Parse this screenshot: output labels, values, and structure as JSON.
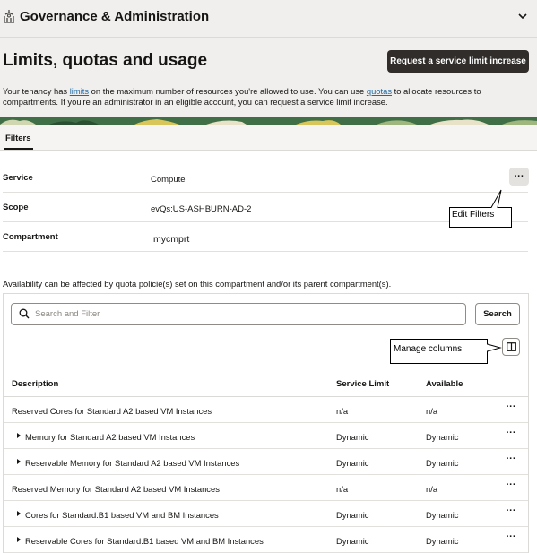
{
  "section": {
    "title": "Governance & Administration"
  },
  "page": {
    "title": "Limits, quotas and usage",
    "request_button": "Request a service limit increase",
    "intro": {
      "p1": "Your tenancy has ",
      "link1": "limits",
      "p2": " on the maximum number of resources you're allowed to use. You can use ",
      "link2": "quotas",
      "p3": " to allocate resources to compartments. If you're an administrator in an eligible account, you can request a service limit increase."
    }
  },
  "tabs": {
    "filters": "Filters"
  },
  "filters": {
    "service_label": "Service",
    "service_value": "Compute",
    "scope_label": "Scope",
    "scope_value": "evQs:US-ASHBURN-AD-2",
    "compartment_label": "Compartment",
    "compartment_value": "mycmprt",
    "more_button": "···"
  },
  "callouts": {
    "edit_filters": "Edit Filters",
    "manage_columns": "Manage columns"
  },
  "note": "Availability can be affected by quota policie(s) set on this compartment and/or its parent compartment(s).",
  "search": {
    "placeholder": "Search and Filter",
    "button": "Search"
  },
  "table": {
    "columns": [
      "Description",
      "Service Limit",
      "Available"
    ],
    "rows": [
      {
        "description": "Reserved Cores for Standard A2 based VM Instances",
        "service_limit": "n/a",
        "available": "n/a",
        "expandable": false,
        "action": "···"
      },
      {
        "description": "Memory for Standard A2 based VM Instances",
        "service_limit": "Dynamic",
        "available": "Dynamic",
        "expandable": true,
        "action": "···"
      },
      {
        "description": "Reservable Memory for Standard A2 based VM Instances",
        "service_limit": "Dynamic",
        "available": "Dynamic",
        "expandable": true,
        "action": "···"
      },
      {
        "description": "Reserved Memory for Standard A2 based VM Instances",
        "service_limit": "n/a",
        "available": "n/a",
        "expandable": false,
        "action": "···"
      },
      {
        "description": "Cores for Standard.B1 based VM and BM Instances",
        "service_limit": "Dynamic",
        "available": "Dynamic",
        "expandable": true,
        "action": "···"
      },
      {
        "description": "Reservable Cores for Standard.B1 based VM and BM Instances",
        "service_limit": "Dynamic",
        "available": "Dynamic",
        "expandable": true,
        "action": "···"
      }
    ]
  },
  "colors": {
    "header_bg": "#f1efed",
    "primary_button": "#312d2a",
    "link": "#1d6aa3",
    "foliage_dark": "#2f5e3a",
    "foliage_yellow": "#d9c65a"
  },
  "icons": {
    "section": "governance-icon",
    "collapse": "chevron-down-icon",
    "search": "search-icon",
    "columns": "columns-icon"
  }
}
